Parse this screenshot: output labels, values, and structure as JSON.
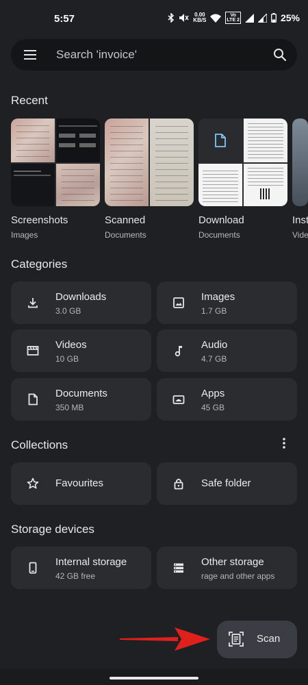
{
  "status": {
    "time": "5:57",
    "net_speed_top": "0.00",
    "net_speed_bottom": "KB/S",
    "lte_top": "Vo",
    "lte_bottom": "LTE 2",
    "battery": "25%"
  },
  "search": {
    "text": "Search 'invoice'"
  },
  "sections": {
    "recent": "Recent",
    "categories": "Categories",
    "collections": "Collections",
    "storage": "Storage devices"
  },
  "recent": [
    {
      "name": "Screenshots",
      "sub": "Images"
    },
    {
      "name": "Scanned",
      "sub": "Documents"
    },
    {
      "name": "Download",
      "sub": "Documents"
    },
    {
      "name": "Inst",
      "sub": "Vide"
    }
  ],
  "categories": [
    {
      "name": "Downloads",
      "size": "3.0 GB",
      "icon": "download-icon"
    },
    {
      "name": "Images",
      "size": "1.7 GB",
      "icon": "image-icon"
    },
    {
      "name": "Videos",
      "size": "10 GB",
      "icon": "video-icon"
    },
    {
      "name": "Audio",
      "size": "4.7 GB",
      "icon": "music-note-icon"
    },
    {
      "name": "Documents",
      "size": "350 MB",
      "icon": "document-icon"
    },
    {
      "name": "Apps",
      "size": "45 GB",
      "icon": "android-icon"
    }
  ],
  "collections": [
    {
      "name": "Favourites",
      "icon": "star-icon"
    },
    {
      "name": "Safe folder",
      "icon": "lock-icon"
    }
  ],
  "storage": [
    {
      "name": "Internal storage",
      "sub": "42 GB free",
      "icon": "phone-icon"
    },
    {
      "name": "Other storage",
      "sub": "rage and other apps",
      "icon": "storage-icon"
    }
  ],
  "fab": {
    "label": "Scan",
    "icon": "document-scanner-icon"
  },
  "colors": {
    "background": "#1f2023",
    "card": "#2b2c2f",
    "fab": "#3a3d44",
    "arrow": "#e0201b"
  }
}
